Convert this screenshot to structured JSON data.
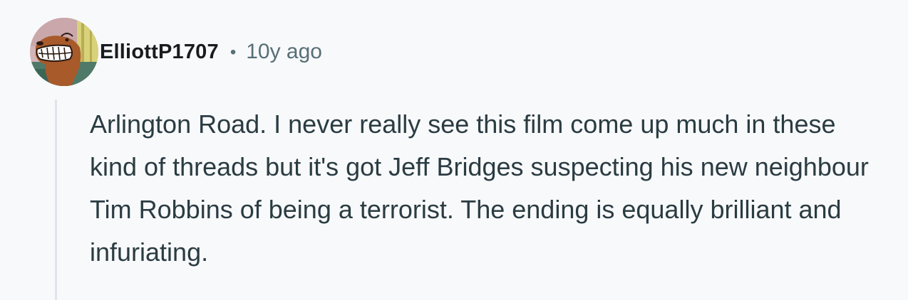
{
  "comment": {
    "author": "ElliottP1707",
    "separator": "•",
    "age": "10y ago",
    "avatar_icon": "cartoon-dog-avatar-icon",
    "body": "Arlington Road. I never really see this film come up much in these kind of threads but it's got Jeff Bridges suspecting his new neighbour Tim Robbins of being a terrorist. The ending is equally brilliant and infuriating."
  },
  "colors": {
    "background": "#f8f9fb",
    "username": "#181c1f",
    "meta": "#576f76",
    "body_text": "#2a3c42",
    "thread_line": "#dfe4ea"
  }
}
